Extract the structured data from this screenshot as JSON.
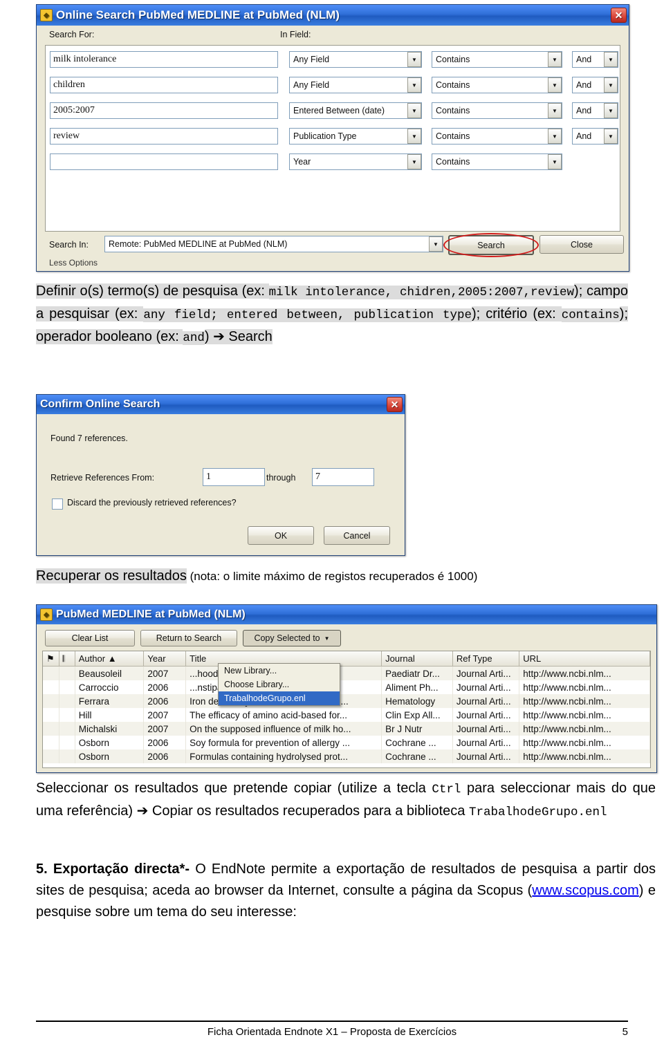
{
  "search_window": {
    "title": "Online Search PubMed MEDLINE at PubMed (NLM)",
    "icon": "pubmed-window-icon",
    "close": "✕",
    "labels": {
      "search_for": "Search For:",
      "in_field": "In Field:",
      "search_in": "Search In:",
      "less_options": "Less Options"
    },
    "rows": [
      {
        "term": "milk intolerance",
        "field": "Any Field",
        "criteria": "Contains",
        "operator": "And"
      },
      {
        "term": "children",
        "field": "Any Field",
        "criteria": "Contains",
        "operator": "And"
      },
      {
        "term": "2005:2007",
        "field": "Entered Between (date)",
        "criteria": "Contains",
        "operator": "And"
      },
      {
        "term": "review",
        "field": "Publication Type",
        "criteria": "Contains",
        "operator": "And"
      },
      {
        "term": "",
        "field": "Year",
        "criteria": "Contains",
        "operator": ""
      }
    ],
    "search_in_value": "Remote: PubMed MEDLINE at PubMed (NLM)",
    "buttons": {
      "search": "Search",
      "close": "Close"
    }
  },
  "caption1": {
    "part1": "Definir o(s) termo(s) de pesquisa (ex: ",
    "mono1": "milk intolerance, chidren,2005:2007,review",
    "part2": "); campo a pesquisar (ex: ",
    "mono2": "any field; entered between, publication type",
    "part3": "); critério (ex: ",
    "mono3": "contains",
    "part4": "); operador booleano (ex: ",
    "mono4": "and",
    "part5": ") ➔ Search"
  },
  "confirm_window": {
    "title": "Confirm Online Search",
    "close": "✕",
    "found": "Found 7 references.",
    "retrieve_label": "Retrieve References From:",
    "from_value": "1",
    "through_label": "through",
    "to_value": "7",
    "discard_label": "Discard the previously retrieved references?",
    "buttons": {
      "ok": "OK",
      "cancel": "Cancel"
    }
  },
  "caption2": {
    "highlight": "Recuperar os resultados",
    "rest": " (nota: o limite máximo de registos recuperados é 1000)"
  },
  "results_window": {
    "title": "PubMed MEDLINE at PubMed (NLM)",
    "toolbar": {
      "clear": "Clear List",
      "return": "Return to Search",
      "copy": "Copy Selected to"
    },
    "menu": [
      {
        "label": "New Library...",
        "selected": false
      },
      {
        "label": "Choose Library...",
        "selected": false
      },
      {
        "label": "TrabalhodeGrupo.enl",
        "selected": true
      }
    ],
    "columns": [
      "",
      "",
      "Author",
      "Year",
      "Title",
      "Journal",
      "Ref Type",
      "URL"
    ],
    "rows": [
      {
        "author": "Beausoleil",
        "year": "2007",
        "title": "...hood asth...",
        "journal": "Paediatr Dr...",
        "reftype": "Journal Arti...",
        "url": "http://www.ncbi.nlm..."
      },
      {
        "author": "Carroccio",
        "year": "2006",
        "title": "...nstipation ...",
        "journal": "Aliment Ph...",
        "reftype": "Journal Arti...",
        "url": "http://www.ncbi.nlm..."
      },
      {
        "author": "Ferrara",
        "year": "2006",
        "title": "Iron deficiency in childhood and adol...",
        "journal": "Hematology",
        "reftype": "Journal Arti...",
        "url": "http://www.ncbi.nlm..."
      },
      {
        "author": "Hill",
        "year": "2007",
        "title": "The efficacy of amino acid-based for...",
        "journal": "Clin Exp All...",
        "reftype": "Journal Arti...",
        "url": "http://www.ncbi.nlm..."
      },
      {
        "author": "Michalski",
        "year": "2007",
        "title": "On the supposed influence of milk ho...",
        "journal": "Br J Nutr",
        "reftype": "Journal Arti...",
        "url": "http://www.ncbi.nlm..."
      },
      {
        "author": "Osborn",
        "year": "2006",
        "title": "Soy formula for prevention of allergy ...",
        "journal": "Cochrane ...",
        "reftype": "Journal Arti...",
        "url": "http://www.ncbi.nlm..."
      },
      {
        "author": "Osborn",
        "year": "2006",
        "title": "Formulas containing hydrolysed prot...",
        "journal": "Cochrane ...",
        "reftype": "Journal Arti...",
        "url": "http://www.ncbi.nlm..."
      }
    ]
  },
  "caption3": {
    "text1": "Seleccionar os resultados que pretende copiar (utilize a tecla ",
    "mono1": "Ctrl",
    "text2": " para seleccionar mais do que uma referência) ➔ Copiar os resultados recuperados para a biblioteca ",
    "mono2": "TrabalhodeGrupo.enl"
  },
  "item5": {
    "number": "5.",
    "bold": "Exportação directa*-",
    "text1": " O EndNote permite a exportação de resultados de pesquisa a partir dos sites de pesquisa; aceda ao browser da Internet, consulte a página da Scopus (",
    "link": "www.scopus.com",
    "text2": ") e pesquise sobre um tema do seu interesse:"
  },
  "footer": {
    "text": "Ficha Orientada Endnote X1 – Proposta de Exercícios",
    "page": "5"
  }
}
